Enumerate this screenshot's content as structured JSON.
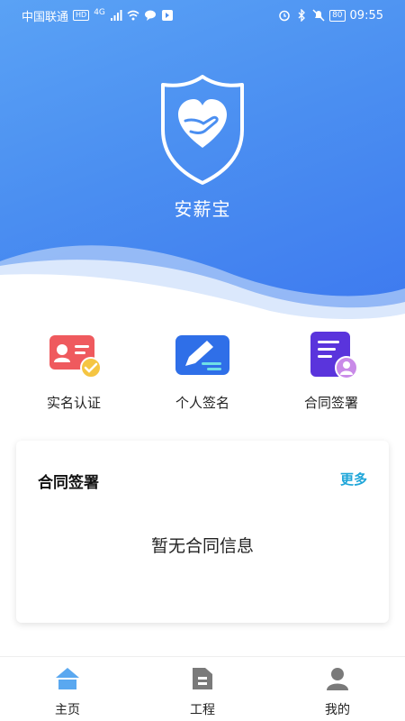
{
  "status_bar": {
    "carrier": "中国联通",
    "hd_badge": "HD",
    "network": "4G",
    "time": "09:55",
    "battery": "80"
  },
  "hero": {
    "app_name": "安薪宝",
    "logo_icon": "shield-heart-hand-icon",
    "gradient_colors": [
      "#5aa2f5",
      "#3d79ef"
    ]
  },
  "quick_actions": [
    {
      "label": "实名认证",
      "icon": "id-card-check-icon",
      "color": "#f05a5a"
    },
    {
      "label": "个人签名",
      "icon": "pen-sign-icon",
      "color": "#2f6fe8"
    },
    {
      "label": "合同签署",
      "icon": "document-user-icon",
      "color": "#6a3ce0"
    }
  ],
  "contract_card": {
    "title": "合同签署",
    "more": "更多",
    "empty_text": "暂无合同信息",
    "accent": "#1fa6d9"
  },
  "tabbar": {
    "items": [
      {
        "label": "主页",
        "icon": "home-icon",
        "active": true
      },
      {
        "label": "工程",
        "icon": "project-folder-icon",
        "active": false
      },
      {
        "label": "我的",
        "icon": "user-icon",
        "active": false
      }
    ]
  }
}
